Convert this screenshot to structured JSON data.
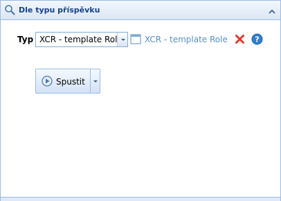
{
  "panel": {
    "title": "Dle typu příspěvku",
    "title_icon": "search-icon",
    "collapse_icon": "chevron-up-icon"
  },
  "form": {
    "type_label": "Typ",
    "type_select_value": "XCR - template Role",
    "open_link_text": "XCR - template Role",
    "open_icon": "window-icon",
    "delete_icon": "delete-icon",
    "help_icon": "help-icon"
  },
  "actions": {
    "run_label": "Spustit",
    "run_icon": "play-icon"
  },
  "colors": {
    "header_text": "#15428b",
    "border": "#99bbe8",
    "link": "#5a8fc6",
    "delete": "#e0392b",
    "help": "#2f7fd0"
  }
}
